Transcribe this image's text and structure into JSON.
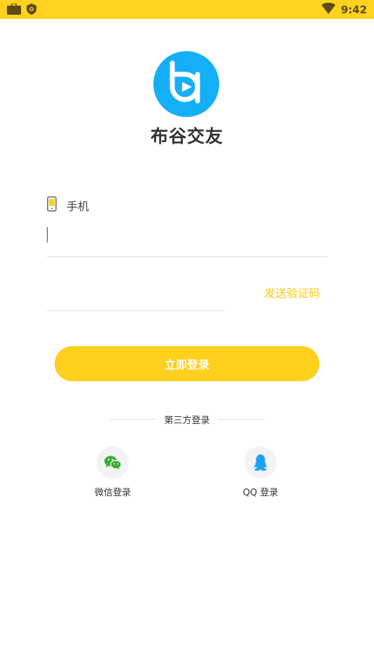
{
  "status_bar": {
    "time": "9:42",
    "left_icons": [
      "briefcase-icon",
      "shield-icon"
    ],
    "right_icons": [
      "wifi-icon"
    ]
  },
  "app": {
    "name": "布谷交友",
    "logo_icon": "logo-icon"
  },
  "phone": {
    "icon": "phone-icon",
    "label": "手机",
    "value": "",
    "placeholder": ""
  },
  "code": {
    "value": "",
    "placeholder": "",
    "send_label": "发送验证码"
  },
  "login_button": "立即登录",
  "third_party": {
    "title": "第三方登录",
    "items": [
      {
        "icon": "wechat-icon",
        "label": "微信登录"
      },
      {
        "icon": "qq-icon",
        "label": "QQ 登录"
      }
    ]
  },
  "colors": {
    "accent": "#FFD01C",
    "status_bar": "#FFD21F",
    "logo_blue": "#14AFF7",
    "send_code": "#FFC915",
    "wechat_green": "#3CB035",
    "qq_blue": "#1DA1F2"
  }
}
